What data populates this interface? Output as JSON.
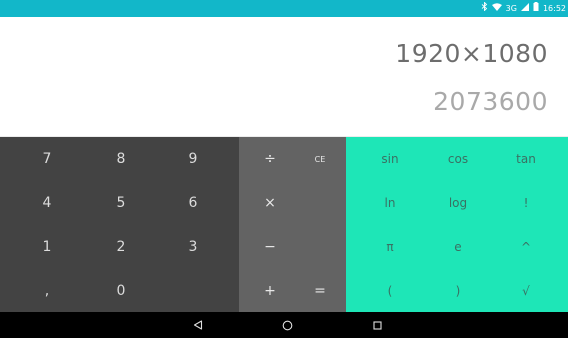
{
  "colors": {
    "status_bar_bg": "#12b7c9",
    "digits_bg": "#434343",
    "ops_bg": "#636363",
    "sci_bg": "#1ee6b7",
    "nav_bg": "#000000",
    "formula_text": "#6d6d6d",
    "result_text": "#a9a9a9"
  },
  "status_bar": {
    "icons": [
      "bluetooth-icon",
      "wifi-icon",
      "signal-icon",
      "battery-icon"
    ],
    "network": "3G",
    "time": "16:52"
  },
  "display": {
    "formula": "1920×1080",
    "result": "2073600"
  },
  "digits": [
    [
      "7",
      "8",
      "9"
    ],
    [
      "4",
      "5",
      "6"
    ],
    [
      "1",
      "2",
      "3"
    ],
    [
      ",",
      "0",
      ""
    ]
  ],
  "operators": {
    "divide": "÷",
    "clear": "CE",
    "multiply": "×",
    "subtract": "−",
    "add": "+",
    "equals": "="
  },
  "scientific": [
    [
      "sin",
      "cos",
      "tan"
    ],
    [
      "ln",
      "log",
      "!"
    ],
    [
      "π",
      "e",
      "^"
    ],
    [
      "(",
      ")",
      "√"
    ]
  ],
  "nav": {
    "icons": [
      "back-icon",
      "home-icon",
      "recents-icon"
    ]
  }
}
